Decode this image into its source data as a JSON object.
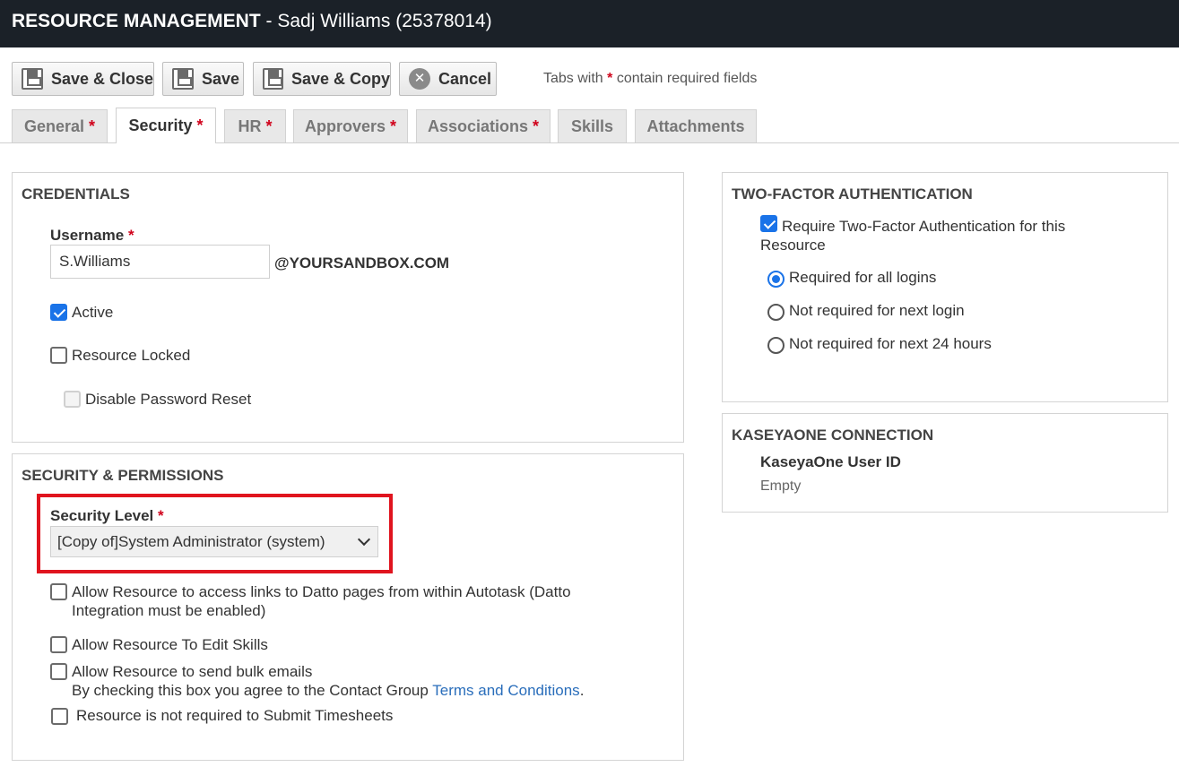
{
  "header": {
    "title_bold": "RESOURCE MANAGEMENT",
    "title_rest": " - Sadj Williams (25378014)"
  },
  "toolbar": {
    "save_close": "Save & Close",
    "save": "Save",
    "save_copy": "Save & Copy",
    "cancel": "Cancel",
    "required_note_prefix": "Tabs with ",
    "required_star": "*",
    "required_note_suffix": " contain required fields"
  },
  "tabs": [
    {
      "label": "General",
      "required": "*"
    },
    {
      "label": "Security",
      "required": "*"
    },
    {
      "label": "HR",
      "required": "*"
    },
    {
      "label": "Approvers",
      "required": "*"
    },
    {
      "label": "Associations",
      "required": "*"
    },
    {
      "label": "Skills",
      "required": ""
    },
    {
      "label": "Attachments",
      "required": ""
    }
  ],
  "credentials": {
    "heading": "CREDENTIALS",
    "username_label": "Username",
    "username_value": "S.Williams",
    "domain_suffix": "@YOURSANDBOX.COM",
    "active_label": "Active",
    "locked_label": "Resource Locked",
    "disable_reset_label": "Disable Password Reset"
  },
  "security": {
    "heading": "SECURITY & PERMISSIONS",
    "level_label": "Security Level",
    "level_value": "[Copy of]System Administrator (system)",
    "datto_line1": "Allow Resource to access links to Datto pages from within Autotask (Datto",
    "datto_line2": "Integration must be enabled)",
    "edit_skills": "Allow Resource To Edit Skills",
    "bulk_emails": "Allow Resource to send bulk emails",
    "agree_prefix": "By checking this box you agree to the Contact Group ",
    "agree_link": "Terms and Conditions",
    "agree_suffix": ".",
    "timesheets": "Resource is not required to Submit Timesheets"
  },
  "two_factor": {
    "heading": "TWO-FACTOR AUTHENTICATION",
    "require_line1": "Require Two-Factor Authentication for this",
    "require_line2": "Resource",
    "option_all": "Required for all logins",
    "option_next": "Not required for next login",
    "option_24h": "Not required for next 24 hours"
  },
  "kaseya": {
    "heading": "KASEYAONE CONNECTION",
    "user_id_label": "KaseyaOne User ID",
    "user_id_value": "Empty"
  }
}
